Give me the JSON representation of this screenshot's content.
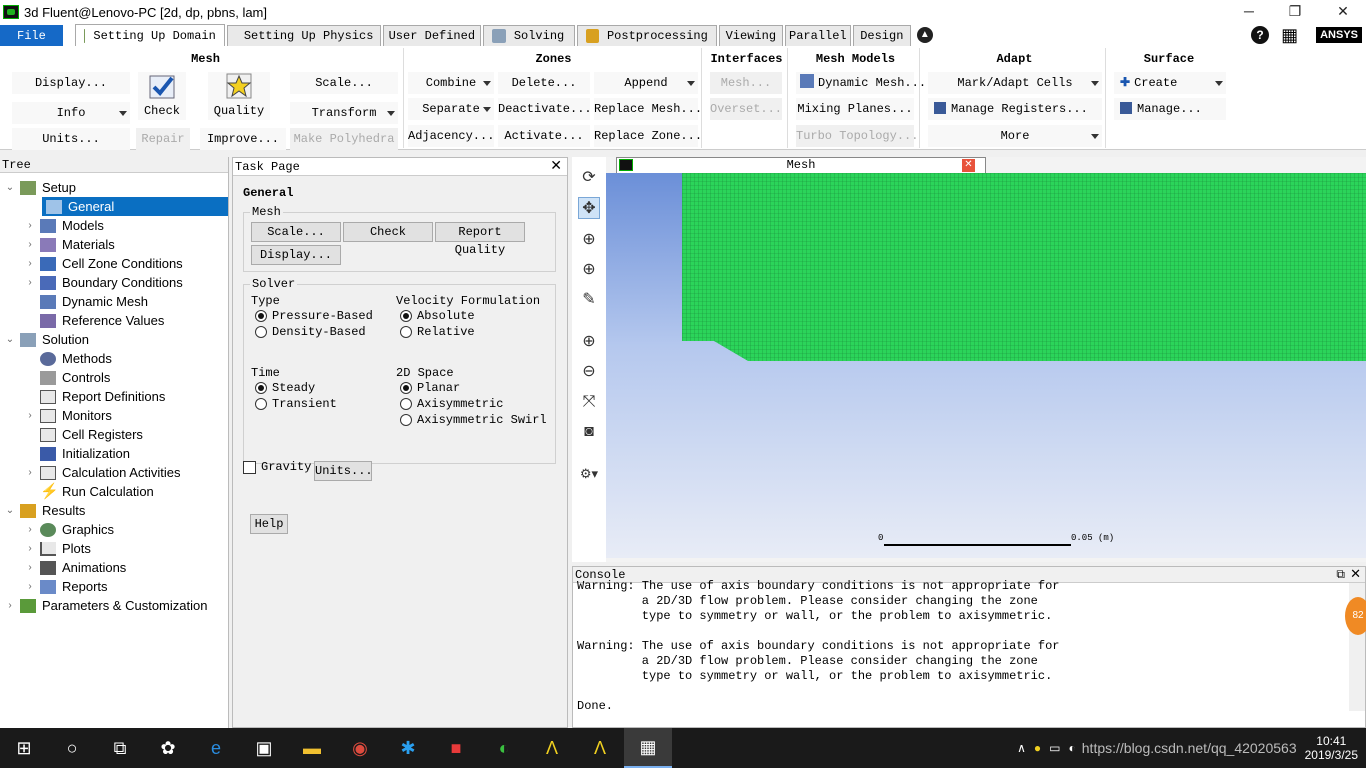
{
  "window": {
    "title": "3d Fluent@Lenovo-PC  [2d, dp, pbns, lam]"
  },
  "ribbon_tabs": [
    {
      "label": "File"
    },
    {
      "label": "Setting Up Domain"
    },
    {
      "label": "Setting Up Physics"
    },
    {
      "label": "User Defined"
    },
    {
      "label": "Solving"
    },
    {
      "label": "Postprocessing"
    },
    {
      "label": "Viewing"
    },
    {
      "label": "Parallel"
    },
    {
      "label": "Design"
    }
  ],
  "brand": "ANSYS",
  "ribbon": {
    "mesh": {
      "title": "Mesh",
      "display": "Display...",
      "info": "Info",
      "units": "Units...",
      "check": "Check",
      "repair": "Repair",
      "quality": "Quality",
      "improve": "Improve...",
      "scale": "Scale...",
      "transform": "Transform",
      "make_polyhedra": "Make Polyhedra"
    },
    "zones": {
      "title": "Zones",
      "combine": "Combine",
      "separate": "Separate",
      "adjacency": "Adjacency...",
      "delete": "Delete...",
      "deactivate": "Deactivate...",
      "activate": "Activate...",
      "append": "Append",
      "replace_mesh": "Replace Mesh...",
      "replace_zone": "Replace Zone..."
    },
    "interfaces": {
      "title": "Interfaces",
      "mesh": "Mesh...",
      "overset": "Overset..."
    },
    "mesh_models": {
      "title": "Mesh Models",
      "dynamic_mesh": "Dynamic Mesh...",
      "mixing_planes": "Mixing Planes...",
      "turbo_topology": "Turbo Topology..."
    },
    "adapt": {
      "title": "Adapt",
      "mark_adapt": "Mark/Adapt Cells",
      "manage_registers": "Manage Registers...",
      "more": "More"
    },
    "surface": {
      "title": "Surface",
      "create": "Create",
      "manage": "Manage..."
    }
  },
  "tree": {
    "header": "Tree",
    "items": [
      {
        "label": "Setup"
      },
      {
        "label": "General"
      },
      {
        "label": "Models"
      },
      {
        "label": "Materials"
      },
      {
        "label": "Cell Zone Conditions"
      },
      {
        "label": "Boundary Conditions"
      },
      {
        "label": "Dynamic Mesh"
      },
      {
        "label": "Reference Values"
      },
      {
        "label": "Solution"
      },
      {
        "label": "Methods"
      },
      {
        "label": "Controls"
      },
      {
        "label": "Report Definitions"
      },
      {
        "label": "Monitors"
      },
      {
        "label": "Cell Registers"
      },
      {
        "label": "Initialization"
      },
      {
        "label": "Calculation Activities"
      },
      {
        "label": "Run Calculation"
      },
      {
        "label": "Results"
      },
      {
        "label": "Graphics"
      },
      {
        "label": "Plots"
      },
      {
        "label": "Animations"
      },
      {
        "label": "Reports"
      },
      {
        "label": "Parameters & Customization"
      }
    ]
  },
  "task_page": {
    "header": "Task Page",
    "title": "General",
    "mesh_group": "Mesh",
    "scale": "Scale...",
    "check": "Check",
    "report_quality": "Report Quality",
    "display": "Display...",
    "solver_group": "Solver",
    "type_label": "Type",
    "pressure_based": "Pressure-Based",
    "density_based": "Density-Based",
    "velocity_label": "Velocity Formulation",
    "absolute": "Absolute",
    "relative": "Relative",
    "time_label": "Time",
    "steady": "Steady",
    "transient": "Transient",
    "space_label": "2D Space",
    "planar": "Planar",
    "axisymmetric": "Axisymmetric",
    "axisymmetric_swirl": "Axisymmetric Swirl",
    "gravity": "Gravity",
    "units": "Units...",
    "help": "Help"
  },
  "graphics": {
    "tab_label": "Mesh",
    "scale_start": "0",
    "scale_end": "0.05 (m)"
  },
  "console": {
    "header": "Console",
    "text": "Warning: The use of axis boundary conditions is not appropriate for\n         a 2D/3D flow problem. Please consider changing the zone\n         type to symmetry or wall, or the problem to axisymmetric.\n\nWarning: The use of axis boundary conditions is not appropriate for\n         a 2D/3D flow problem. Please consider changing the zone\n         type to symmetry or wall, or the problem to axisymmetric.\n\nDone."
  },
  "taskbar": {
    "time": "10:41",
    "date": "2019/3/25",
    "watermark": "https://blog.csdn.net/qq_42020563",
    "badge": "82"
  },
  "colors": {
    "accent": "#1569c7",
    "selection": "#0a6fc2",
    "mesh": "#2ecc40"
  }
}
